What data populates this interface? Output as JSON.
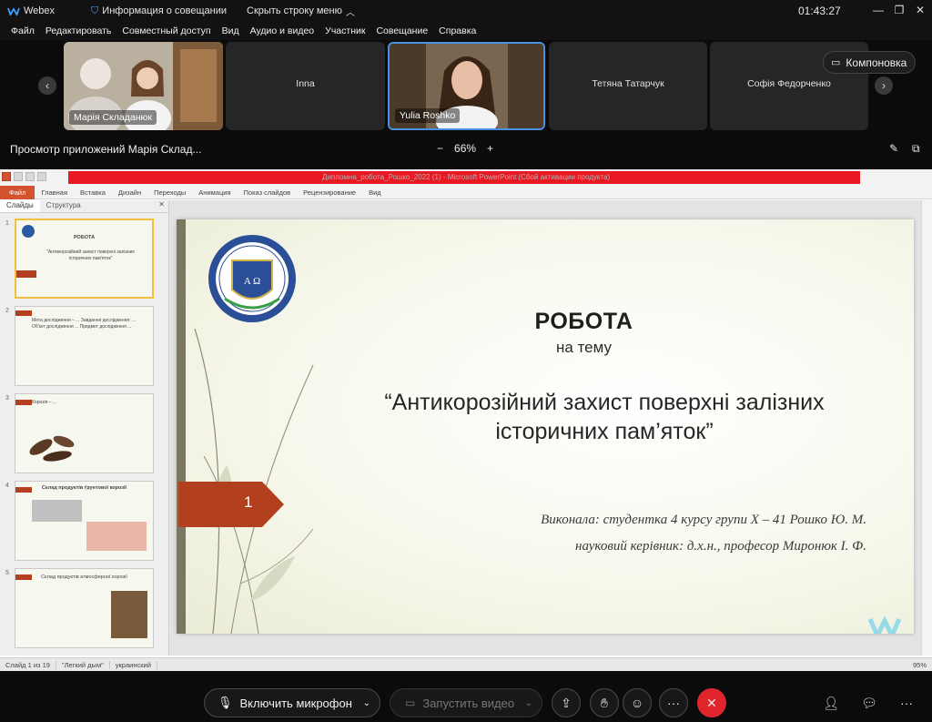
{
  "titlebar": {
    "app_name": "Webex",
    "meeting_info": "Информация о совещании",
    "hide_menu": "Скрыть строку меню",
    "clock": "01:43:27"
  },
  "menu": [
    "Файл",
    "Редактировать",
    "Совместный доступ",
    "Вид",
    "Аудио и видео",
    "Участник",
    "Совещание",
    "Справка"
  ],
  "participants": [
    {
      "name": "Марія Складанюк",
      "video": true
    },
    {
      "name": "Inna",
      "video": false
    },
    {
      "name": "Yulia Roshko",
      "video": true,
      "active": true
    },
    {
      "name": "Тетяна Татарчук",
      "video": false
    },
    {
      "name": "Софія Федорченко",
      "video": false
    }
  ],
  "layout_button": "Компоновка",
  "share": {
    "title": "Просмотр приложений Марія Склад...",
    "zoom": "66%",
    "zoom_minus": "−",
    "zoom_plus": "+"
  },
  "ppt": {
    "doc_title": "Дипломна_робота_Рошко_2022 (1) - Microsoft PowerPoint (Сбой активации продукта)",
    "ribbon": [
      "Файл",
      "Главная",
      "Вставка",
      "Дизайн",
      "Переходы",
      "Анимация",
      "Показ слайдов",
      "Рецензирование",
      "Вид"
    ],
    "pane_tabs": [
      "Слайды",
      "Структура"
    ],
    "thumbs": [
      {
        "num": "1",
        "title": "РОБОТА",
        "text": "\"Антикорозійний захист поверхні залізних історичних пам'яток\""
      },
      {
        "num": "2",
        "title": "",
        "text": "Мета дослідження – ... Завдання дослідження: ... Об'єкт дослідження ... Предмет дослідження ..."
      },
      {
        "num": "3",
        "title": "",
        "text": "Корозія – ..."
      },
      {
        "num": "4",
        "title": "Склад продуктів ґрунтової корозії",
        "text": ""
      },
      {
        "num": "5",
        "title": "Склад продуктів атмосферної корозії",
        "text": ""
      }
    ],
    "slide": {
      "number": "1",
      "heading": "РОБОТА",
      "subheading": "на тему",
      "topic_line1": "“Антикорозійний захист поверхні залізних",
      "topic_line2": "історичних пам’яток”",
      "author_line": "Виконала: студентка 4 курсу групи  Х – 41  Рошко Ю. М.",
      "advisor_line": "науковий керівник: д.х.н., професор Миронюк І. Ф."
    },
    "status": {
      "slide_of": "Слайд 1 из 19",
      "theme": "\"Легкий дым\"",
      "lang": "украинский",
      "zoom": "95%"
    }
  },
  "controls": {
    "mic": "Включить микрофон",
    "video": "Запустить видео",
    "more": "···",
    "end": "✕"
  },
  "colors": {
    "accent": "#e0262c",
    "active_tile_border": "#4a90e2",
    "slide_arrow": "#b2401f"
  }
}
